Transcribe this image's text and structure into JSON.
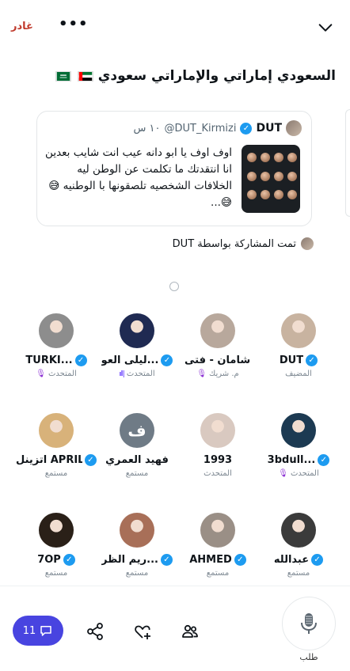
{
  "header": {
    "leave_label": "غادر",
    "more_label": "•••"
  },
  "space": {
    "title": "السعودي إماراتي والإماراتي سعودي"
  },
  "tweet": {
    "name": "DUT",
    "handle": "@DUT_Kirmizi",
    "time": "١٠ س",
    "text": "اوف اوف يا ابو دانه عيب انت شايب بعدين انا انتقدتك ما تكلمت عن الوطن ليه الخلافات الشخصيه تلصقونها با الوطنيه 😅😅..."
  },
  "shared_by": "تمت المشاركة بواسطة DUT",
  "participants": [
    {
      "name": "DUT",
      "verified": true,
      "role": "المضيف",
      "role_icon": "",
      "avatar_color": "#c8b3a0",
      "avatar_letter": ""
    },
    {
      "name": "شامان - فتى...",
      "verified": false,
      "role": "م. شريك",
      "role_icon": "mic-off",
      "avatar_color": "#b8a89c",
      "avatar_letter": ""
    },
    {
      "name": "ليلى العو...",
      "verified": true,
      "role": "المتحدث",
      "role_icon": "bars",
      "avatar_color": "#1f2a52",
      "avatar_letter": ""
    },
    {
      "name": "TURKI...",
      "verified": true,
      "role": "المتحدث",
      "role_icon": "mic-off",
      "avatar_color": "#8d8d8d",
      "avatar_letter": ""
    },
    {
      "name": "3bdull...",
      "verified": true,
      "role": "المتحدث",
      "role_icon": "mic-off",
      "avatar_color": "#1c3a52",
      "avatar_letter": ""
    },
    {
      "name": "1993",
      "verified": false,
      "role": "المتحدث",
      "role_icon": "",
      "avatar_color": "#d9c9c0",
      "avatar_letter": ""
    },
    {
      "name": "فهيد العمري",
      "verified": false,
      "role": "مستمع",
      "role_icon": "",
      "avatar_color": "#6f7b86",
      "avatar_letter": "ف"
    },
    {
      "name": "اتزينل APRIL",
      "verified": true,
      "role": "مستمع",
      "role_icon": "",
      "avatar_color": "#d8b27a",
      "avatar_letter": ""
    },
    {
      "name": "عبدالله",
      "verified": true,
      "role": "مستمع",
      "role_icon": "",
      "avatar_color": "#3b3b3b",
      "avatar_letter": ""
    },
    {
      "name": "AHMED",
      "verified": true,
      "role": "مستمع",
      "role_icon": "",
      "avatar_color": "#9a8f86",
      "avatar_letter": ""
    },
    {
      "name": "ريم الظر...",
      "verified": true,
      "role": "مستمع",
      "role_icon": "",
      "avatar_color": "#a86f58",
      "avatar_letter": ""
    },
    {
      "name": "7OP",
      "verified": true,
      "role": "مستمع",
      "role_icon": "",
      "avatar_color": "#2a2018",
      "avatar_letter": ""
    }
  ],
  "bottom": {
    "comments_count": "11",
    "request_label": "طلب"
  },
  "colors": {
    "accent": "#4844e0",
    "verified": "#1d9bf0",
    "leave": "#c0392b",
    "mic_off": "#e0245e"
  }
}
